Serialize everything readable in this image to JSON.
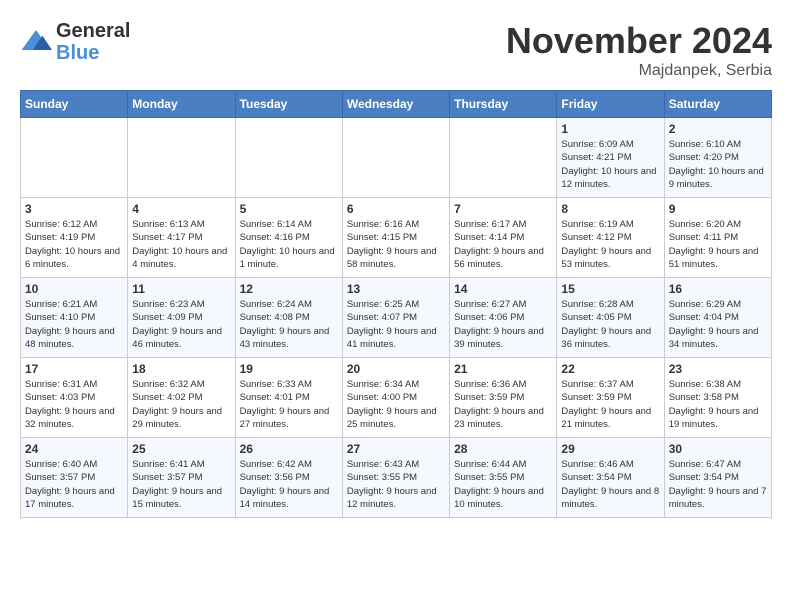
{
  "logo": {
    "general": "General",
    "blue": "Blue"
  },
  "title": "November 2024",
  "location": "Majdanpek, Serbia",
  "days_of_week": [
    "Sunday",
    "Monday",
    "Tuesday",
    "Wednesday",
    "Thursday",
    "Friday",
    "Saturday"
  ],
  "weeks": [
    [
      {
        "day": "",
        "info": ""
      },
      {
        "day": "",
        "info": ""
      },
      {
        "day": "",
        "info": ""
      },
      {
        "day": "",
        "info": ""
      },
      {
        "day": "",
        "info": ""
      },
      {
        "day": "1",
        "info": "Sunrise: 6:09 AM\nSunset: 4:21 PM\nDaylight: 10 hours and 12 minutes."
      },
      {
        "day": "2",
        "info": "Sunrise: 6:10 AM\nSunset: 4:20 PM\nDaylight: 10 hours and 9 minutes."
      }
    ],
    [
      {
        "day": "3",
        "info": "Sunrise: 6:12 AM\nSunset: 4:19 PM\nDaylight: 10 hours and 6 minutes."
      },
      {
        "day": "4",
        "info": "Sunrise: 6:13 AM\nSunset: 4:17 PM\nDaylight: 10 hours and 4 minutes."
      },
      {
        "day": "5",
        "info": "Sunrise: 6:14 AM\nSunset: 4:16 PM\nDaylight: 10 hours and 1 minute."
      },
      {
        "day": "6",
        "info": "Sunrise: 6:16 AM\nSunset: 4:15 PM\nDaylight: 9 hours and 58 minutes."
      },
      {
        "day": "7",
        "info": "Sunrise: 6:17 AM\nSunset: 4:14 PM\nDaylight: 9 hours and 56 minutes."
      },
      {
        "day": "8",
        "info": "Sunrise: 6:19 AM\nSunset: 4:12 PM\nDaylight: 9 hours and 53 minutes."
      },
      {
        "day": "9",
        "info": "Sunrise: 6:20 AM\nSunset: 4:11 PM\nDaylight: 9 hours and 51 minutes."
      }
    ],
    [
      {
        "day": "10",
        "info": "Sunrise: 6:21 AM\nSunset: 4:10 PM\nDaylight: 9 hours and 48 minutes."
      },
      {
        "day": "11",
        "info": "Sunrise: 6:23 AM\nSunset: 4:09 PM\nDaylight: 9 hours and 46 minutes."
      },
      {
        "day": "12",
        "info": "Sunrise: 6:24 AM\nSunset: 4:08 PM\nDaylight: 9 hours and 43 minutes."
      },
      {
        "day": "13",
        "info": "Sunrise: 6:25 AM\nSunset: 4:07 PM\nDaylight: 9 hours and 41 minutes."
      },
      {
        "day": "14",
        "info": "Sunrise: 6:27 AM\nSunset: 4:06 PM\nDaylight: 9 hours and 39 minutes."
      },
      {
        "day": "15",
        "info": "Sunrise: 6:28 AM\nSunset: 4:05 PM\nDaylight: 9 hours and 36 minutes."
      },
      {
        "day": "16",
        "info": "Sunrise: 6:29 AM\nSunset: 4:04 PM\nDaylight: 9 hours and 34 minutes."
      }
    ],
    [
      {
        "day": "17",
        "info": "Sunrise: 6:31 AM\nSunset: 4:03 PM\nDaylight: 9 hours and 32 minutes."
      },
      {
        "day": "18",
        "info": "Sunrise: 6:32 AM\nSunset: 4:02 PM\nDaylight: 9 hours and 29 minutes."
      },
      {
        "day": "19",
        "info": "Sunrise: 6:33 AM\nSunset: 4:01 PM\nDaylight: 9 hours and 27 minutes."
      },
      {
        "day": "20",
        "info": "Sunrise: 6:34 AM\nSunset: 4:00 PM\nDaylight: 9 hours and 25 minutes."
      },
      {
        "day": "21",
        "info": "Sunrise: 6:36 AM\nSunset: 3:59 PM\nDaylight: 9 hours and 23 minutes."
      },
      {
        "day": "22",
        "info": "Sunrise: 6:37 AM\nSunset: 3:59 PM\nDaylight: 9 hours and 21 minutes."
      },
      {
        "day": "23",
        "info": "Sunrise: 6:38 AM\nSunset: 3:58 PM\nDaylight: 9 hours and 19 minutes."
      }
    ],
    [
      {
        "day": "24",
        "info": "Sunrise: 6:40 AM\nSunset: 3:57 PM\nDaylight: 9 hours and 17 minutes."
      },
      {
        "day": "25",
        "info": "Sunrise: 6:41 AM\nSunset: 3:57 PM\nDaylight: 9 hours and 15 minutes."
      },
      {
        "day": "26",
        "info": "Sunrise: 6:42 AM\nSunset: 3:56 PM\nDaylight: 9 hours and 14 minutes."
      },
      {
        "day": "27",
        "info": "Sunrise: 6:43 AM\nSunset: 3:55 PM\nDaylight: 9 hours and 12 minutes."
      },
      {
        "day": "28",
        "info": "Sunrise: 6:44 AM\nSunset: 3:55 PM\nDaylight: 9 hours and 10 minutes."
      },
      {
        "day": "29",
        "info": "Sunrise: 6:46 AM\nSunset: 3:54 PM\nDaylight: 9 hours and 8 minutes."
      },
      {
        "day": "30",
        "info": "Sunrise: 6:47 AM\nSunset: 3:54 PM\nDaylight: 9 hours and 7 minutes."
      }
    ]
  ]
}
